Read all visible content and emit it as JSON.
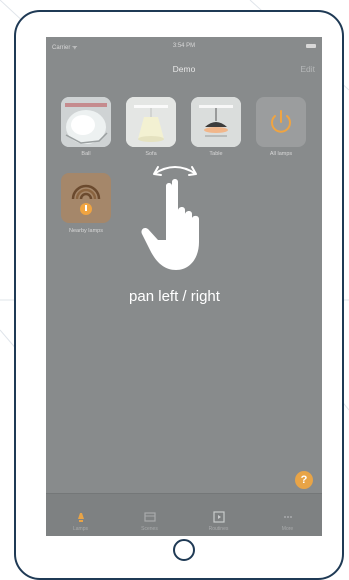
{
  "status_bar": {
    "carrier": "Carrier ᯤ",
    "time": "3:54 PM"
  },
  "nav": {
    "title": "Demo",
    "edit_label": "Edit"
  },
  "tiles": [
    {
      "label": "Ball",
      "icon": "ball-lamp-photo-icon"
    },
    {
      "label": "Sofa",
      "icon": "sofa-lamp-photo-icon"
    },
    {
      "label": "Table",
      "icon": "table-lamp-photo-icon"
    },
    {
      "label": "All lamps",
      "icon": "power-icon"
    },
    {
      "label": "Nearby lamps",
      "icon": "nearby-signal-icon"
    }
  ],
  "gesture": {
    "text": "pan left / right",
    "icon": "hand-swipe-icon"
  },
  "help_label": "?",
  "tabs": [
    {
      "label": "Lamps",
      "icon": "lamp-icon"
    },
    {
      "label": "Scenes",
      "icon": "scenes-icon"
    },
    {
      "label": "Routines",
      "icon": "routines-icon"
    },
    {
      "label": "More",
      "icon": "more-icon"
    }
  ],
  "colors": {
    "device_frame": "#1f3a55",
    "screen_bg": "#888b8c",
    "help_button": "#e8a447",
    "tile_orange_bg": "#a5876a",
    "tile_power_bg": "#9b9d9e"
  }
}
